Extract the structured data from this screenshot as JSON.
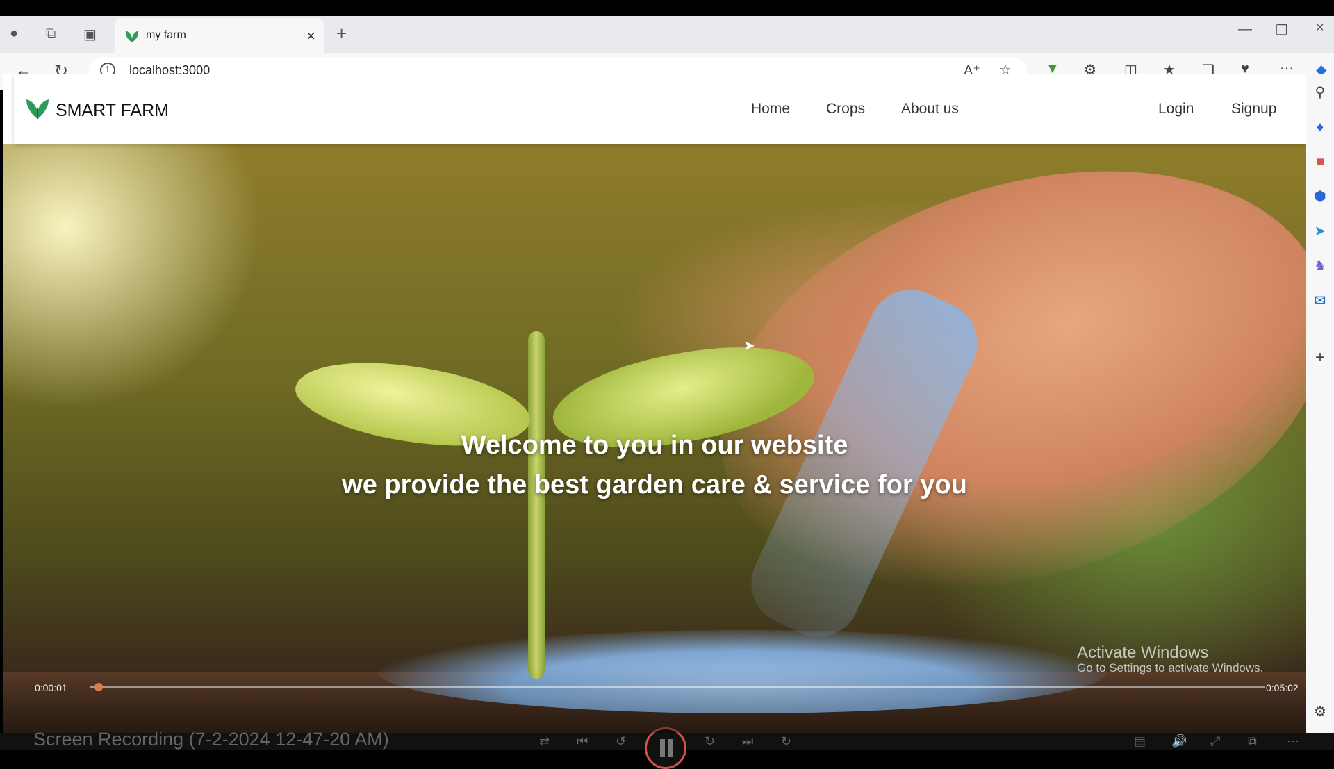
{
  "browser": {
    "tab_title": "my farm",
    "url": "localhost:3000"
  },
  "site": {
    "brand": "SMART FARM",
    "nav": [
      "Home",
      "Crops",
      "About us"
    ],
    "auth": [
      "Login",
      "Signup"
    ]
  },
  "hero": {
    "line1": "Welcome to you in our website",
    "line2": "we provide the best garden care & service for you"
  },
  "player": {
    "current_time": "0:00:01",
    "total_time": "0:05:02",
    "caption": "Screen Recording (7-2-2024 12-47-20 AM)"
  },
  "watermark": {
    "title": "Activate Windows",
    "subtitle": "Go to Settings to activate Windows."
  },
  "colors": {
    "brand_leaf": "#2e9b5a",
    "seek_thumb": "#e07a4a",
    "pause_ring": "#d4524a"
  }
}
